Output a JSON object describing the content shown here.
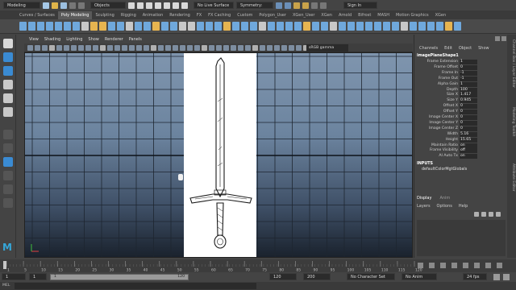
{
  "status": {
    "menuset": "Modeling",
    "objects": "Objects",
    "live_surface": "No Live Surface",
    "symmetry": "Symmetry: Off",
    "sign_in": "Sign In"
  },
  "shelf_tabs": [
    "Curves / Surfaces",
    "Poly Modeling",
    "Sculpting",
    "Rigging",
    "Animation",
    "Rendering",
    "FX",
    "FX Caching",
    "Custom",
    "Polygon_User",
    "XGen_User",
    "XGen",
    "Arnold",
    "Bifrost",
    "MASH",
    "Motion Graphics",
    "XGen"
  ],
  "active_shelf": "Poly Modeling",
  "viewport_menu": [
    "View",
    "Shading",
    "Lighting",
    "Show",
    "Renderer",
    "Panels"
  ],
  "color_space": "sRGB gamma",
  "channel_box": {
    "tabs": [
      "Channels",
      "Edit",
      "Object",
      "Show"
    ],
    "node": "imagePlaneShape1",
    "rows": [
      {
        "label": "Frame Extension",
        "value": "1"
      },
      {
        "label": "Frame Offset",
        "value": "0"
      },
      {
        "label": "Frame In",
        "value": "-1"
      },
      {
        "label": "Frame Out",
        "value": "-1"
      },
      {
        "label": "Alpha Gain",
        "value": "1"
      },
      {
        "label": "Depth",
        "value": "100"
      },
      {
        "label": "Size X",
        "value": "1.417"
      },
      {
        "label": "Size Y",
        "value": "0.945"
      },
      {
        "label": "Offset X",
        "value": "0"
      },
      {
        "label": "Offset Y",
        "value": "0"
      },
      {
        "label": "Image Center X",
        "value": "0"
      },
      {
        "label": "Image Center Y",
        "value": "0"
      },
      {
        "label": "Image Center Z",
        "value": "0"
      },
      {
        "label": "Width",
        "value": "5.16"
      },
      {
        "label": "Height",
        "value": "15.65"
      },
      {
        "label": "Maintain Ratio",
        "value": "on"
      },
      {
        "label": "Frame Visibility",
        "value": "off"
      },
      {
        "label": "AI Auto Tx",
        "value": "on"
      }
    ],
    "inputs_header": "INPUTS",
    "inputs_item": "defaultColorMgtGlobals"
  },
  "layer_editor": {
    "tabs": [
      "Display",
      "Anim"
    ],
    "menu": [
      "Layers",
      "Options",
      "Help"
    ]
  },
  "side_tabs": [
    "Channel Box / Layer Editor",
    "Modeling Toolkit",
    "Attribute Editor"
  ],
  "timeline": {
    "ticks": [
      "1",
      "5",
      "10",
      "15",
      "20",
      "25",
      "30",
      "35",
      "40",
      "45",
      "50",
      "55",
      "60",
      "65",
      "70",
      "75",
      "80",
      "85",
      "90",
      "95",
      "100",
      "105",
      "110",
      "115",
      "120"
    ],
    "current_frame": "1"
  },
  "range": {
    "start": "1",
    "anim_start": "1",
    "range_end": "120",
    "end_a": "120",
    "end_b": "200",
    "character_set": "No Character Set",
    "anim_layer": "No Anim Layer",
    "fps": "24 fps"
  },
  "cmd": {
    "label": "MEL"
  },
  "colors": {
    "accent": "#3a8bd3",
    "select": "#5a5a5a"
  }
}
